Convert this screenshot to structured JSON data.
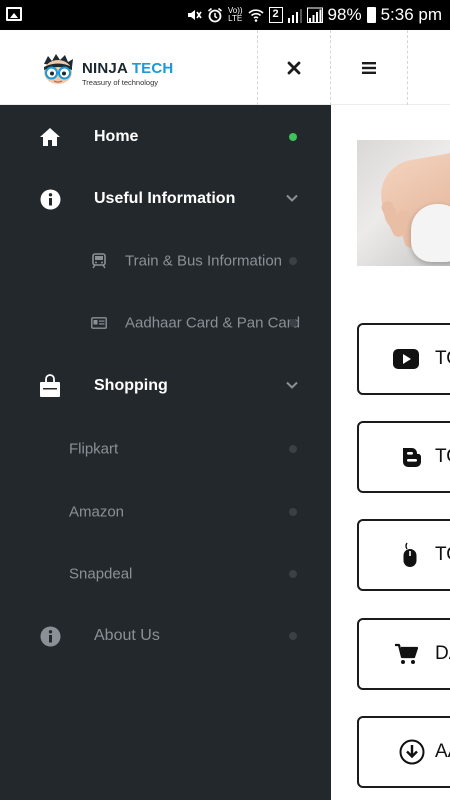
{
  "status_bar": {
    "battery": "98%",
    "time": "5:36 pm",
    "sim_badge": "2",
    "volte_top": "Vo))",
    "volte_bottom": "LTE"
  },
  "header": {
    "brand_part1": "NINJA",
    "brand_part2": " TECH",
    "tagline": "Treasury of technology",
    "close_glyph": "✕"
  },
  "colors": {
    "sidebar_bg": "#23282c",
    "active_dot": "#3cc35c",
    "inactive_dot": "#3a4045",
    "text_primary": "#ffffff",
    "text_muted": "#8a9096",
    "brand_accent": "#1a9ad6"
  },
  "sidebar": {
    "items": [
      {
        "label": "Home",
        "icon": "home-icon",
        "type": "link",
        "active": true
      },
      {
        "label": "Useful Information",
        "icon": "info-icon",
        "type": "expandable"
      },
      {
        "label": "Train & Bus Information",
        "icon": "train-icon",
        "type": "sublink"
      },
      {
        "label": "Aadhaar Card & Pan Card",
        "icon": "id-card-icon",
        "type": "sublink"
      },
      {
        "label": "Shopping",
        "icon": "shopping-bag-icon",
        "type": "expandable"
      },
      {
        "label": "Flipkart",
        "type": "sublink"
      },
      {
        "label": "Amazon",
        "type": "sublink"
      },
      {
        "label": "Snapdeal",
        "type": "sublink"
      },
      {
        "label": "About Us",
        "icon": "info-icon",
        "type": "link"
      }
    ]
  },
  "content": {
    "cards": [
      {
        "label": "TO",
        "icon": "youtube-icon"
      },
      {
        "label": "TO",
        "icon": "blogger-icon"
      },
      {
        "label": "TO",
        "icon": "mouse-icon"
      },
      {
        "label": "DA",
        "icon": "cart-icon"
      },
      {
        "label": "AA",
        "icon": "download-icon"
      }
    ]
  }
}
